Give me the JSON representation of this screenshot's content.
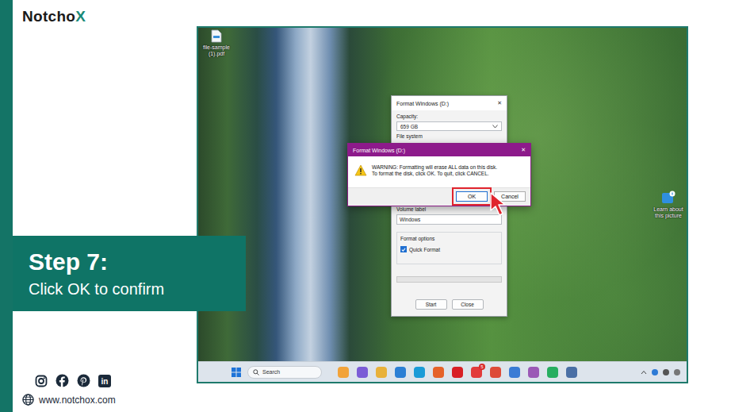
{
  "brand": {
    "logo_main": "Notcho",
    "logo_accent": "X"
  },
  "step": {
    "title": "Step 7:",
    "caption": "Click OK to confirm"
  },
  "social": {
    "linkedin_mark": "in"
  },
  "website": "www.notchox.com",
  "desktop": {
    "file_icon": {
      "label": "file-sample (1).pdf"
    },
    "spotlight_icon": {
      "label": "Learn about this picture"
    }
  },
  "format_dialog": {
    "title": "Format Windows (D:)",
    "close": "✕",
    "capacity_label": "Capacity:",
    "capacity_value": "659 GB",
    "file_system_label": "File system",
    "volume_label": "Volume label",
    "volume_value": "Windows",
    "options_label": "Format options",
    "quick_format": {
      "label": "Quick Format",
      "checked": true
    },
    "progress": {
      "level": 0
    },
    "buttons": [
      "Start",
      "Close"
    ]
  },
  "warning": {
    "title": "Format Windows (D:)",
    "close": "✕",
    "message": [
      "WARNING: Formatting will erase ALL data on this disk.",
      "To format the disk, click OK. To quit, click CANCEL."
    ],
    "buttons": [
      {
        "label": "OK",
        "selected": true
      },
      {
        "label": "Cancel",
        "selected": false
      }
    ]
  },
  "taskbar": {
    "search": "Search",
    "apps": [
      {
        "color": "#f2a33a"
      },
      {
        "color": "#7b5cd6"
      },
      {
        "color": "#e8b13a"
      },
      {
        "color": "#2b7fd4"
      },
      {
        "color": "#1a9bd7"
      },
      {
        "color": "#e5622a"
      },
      {
        "color": "#d81f26"
      },
      {
        "color": "#e23b3b",
        "badge": "5"
      },
      {
        "color": "#dd4b39"
      },
      {
        "color": "#3a7bd5"
      },
      {
        "color": "#9b59b6"
      },
      {
        "color": "#27ae60"
      },
      {
        "color": "#4a6fa5"
      }
    ]
  }
}
